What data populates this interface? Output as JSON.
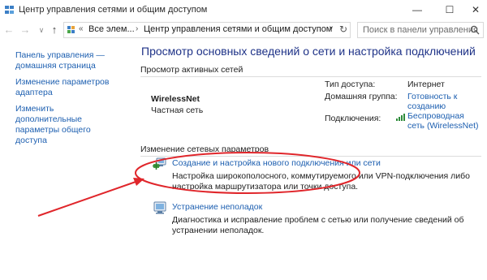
{
  "window": {
    "title": "Центр управления сетями и общим доступом",
    "minimize_glyph": "—",
    "maximize_glyph": "☐",
    "close_glyph": "✕"
  },
  "nav": {
    "back_glyph": "←",
    "forward_glyph": "→",
    "recent_glyph": "∨",
    "up_glyph": "↑",
    "address_prefix": "«",
    "address_parts": [
      "Все элем...",
      "Центр управления сетями и общим доступом"
    ],
    "dropdown_glyph": "∨",
    "refresh_glyph": "↻",
    "search_placeholder": "Поиск в панели управления"
  },
  "sidebar": {
    "items": [
      {
        "label": "Панель управления — домашняя страница"
      },
      {
        "label": "Изменение параметров адаптера"
      },
      {
        "label": "Изменить дополнительные параметры общего доступа"
      }
    ]
  },
  "main": {
    "title": "Просмотр основных сведений о сети и настройка подключений",
    "active_header": "Просмотр активных сетей",
    "network": {
      "name": "WirelessNet",
      "type": "Частная сеть",
      "access_label": "Тип доступа:",
      "access_value": "Интернет",
      "homegroup_label": "Домашняя группа:",
      "homegroup_value": "Готовность к созданию",
      "connections_label": "Подключения:",
      "connections_value": "Беспроводная сеть (WirelessNet)"
    },
    "change_header": "Изменение сетевых параметров",
    "tasks": [
      {
        "icon": "new-connection-icon",
        "link": "Создание и настройка нового подключения или сети",
        "desc": "Настройка широкополосного, коммутируемого или VPN-подключения либо настройка маршрутизатора или точки доступа."
      },
      {
        "icon": "troubleshoot-icon",
        "link": "Устранение неполадок",
        "desc": "Диагностика и исправление проблем с сетью или получение сведений об устранении неполадок."
      }
    ]
  },
  "colors": {
    "link": "#1d5fb0",
    "title": "#1e3287",
    "annotation": "#e0262b"
  }
}
